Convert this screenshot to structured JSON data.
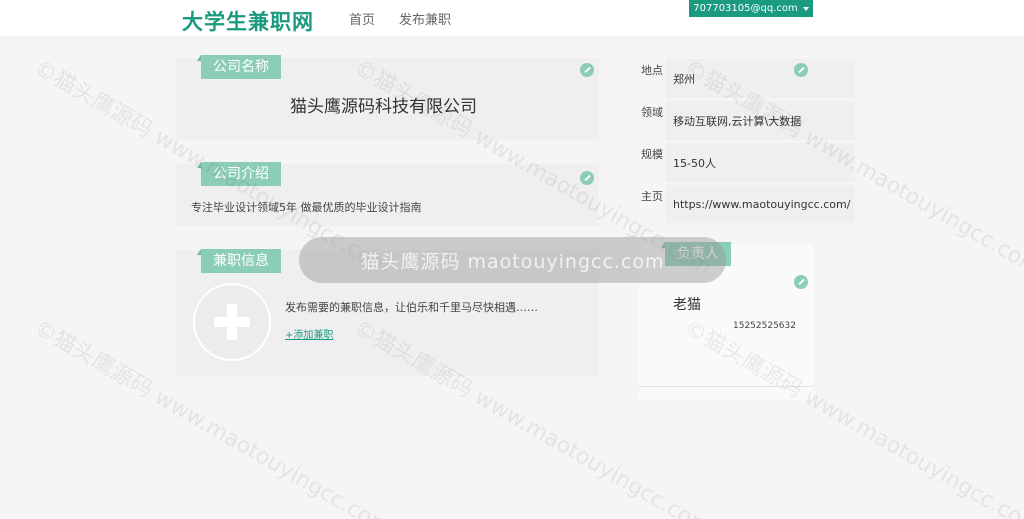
{
  "header": {
    "logo": "大学生兼职网",
    "nav": {
      "home": "首页",
      "publish": "发布兼职"
    },
    "user_email": "707703105@qq.com"
  },
  "company": {
    "name_tag": "公司名称",
    "name": "猫头鹰源码科技有限公司",
    "intro_tag": "公司介绍",
    "intro": "专注毕业设计领域5年 做最优质的毕业设计指南",
    "jobs_tag": "兼职信息",
    "jobs_desc": "发布需要的兼职信息，让伯乐和千里马尽快相遇……",
    "add_job": "+添加兼职"
  },
  "info": [
    {
      "label": "地点",
      "value": "郑州"
    },
    {
      "label": "领域",
      "value": "移动互联网,云计算\\大数据"
    },
    {
      "label": "规模",
      "value": "15-50人"
    },
    {
      "label": "主页",
      "value": "https://www.maotouyingcc.com/"
    }
  ],
  "owner": {
    "tag": "负责人",
    "name": "老猫",
    "phone": "15252525632"
  },
  "watermark": "©猫头鹰源码 www.maotouyingcc.com",
  "overlay": "猫头鹰源码 maotouyingcc.com",
  "colors": {
    "accent": "#1a9a7e",
    "tag": "#8ccdb7"
  }
}
